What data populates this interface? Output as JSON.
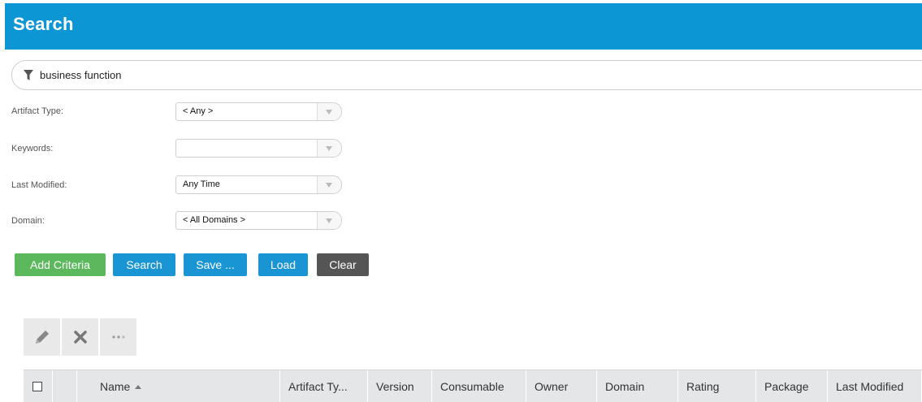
{
  "header": {
    "title": "Search"
  },
  "filter": {
    "text": "business function"
  },
  "fields": [
    {
      "label": "Artifact Type:",
      "value": "< Any >"
    },
    {
      "label": "Keywords:",
      "value": ""
    },
    {
      "label": "Last Modified:",
      "value": "Any Time"
    },
    {
      "label": "Domain:",
      "value": "< All Domains >"
    }
  ],
  "buttons": {
    "add_criteria": "Add Criteria",
    "search": "Search",
    "save": "Save ...",
    "load": "Load",
    "clear": "Clear"
  },
  "toolbar": {
    "more": "···"
  },
  "columns": [
    {
      "label": ""
    },
    {
      "label": "Name",
      "sort": "ascending"
    },
    {
      "label": "Artifact Ty..."
    },
    {
      "label": "Version"
    },
    {
      "label": "Consumable"
    },
    {
      "label": "Owner"
    },
    {
      "label": "Domain"
    },
    {
      "label": "Rating"
    },
    {
      "label": "Package"
    },
    {
      "label": "Last Modified"
    }
  ],
  "colors": {
    "header_blue": "#0d96d4",
    "button_green": "#5cb85c",
    "button_blue": "#1a95d3",
    "button_dark": "#555555"
  }
}
